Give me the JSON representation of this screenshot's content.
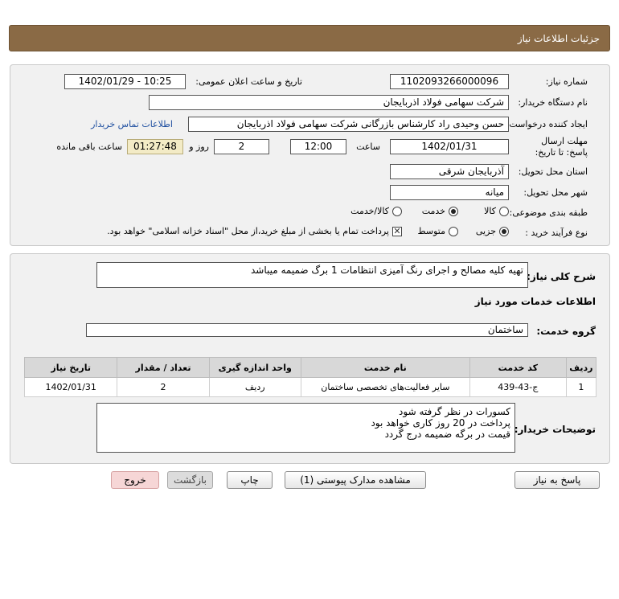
{
  "header": {
    "title": "جزئیات اطلاعات نیاز"
  },
  "form": {
    "need_number_label": "شماره نیاز:",
    "need_number": "1102093266000096",
    "announce_label": "تاریخ و ساعت اعلان عمومی:",
    "announce_value": "1402/01/29 - 10:25",
    "buyer_org_label": "نام دستگاه خریدار:",
    "buyer_org": "شرکت سهامی فولاد اذربایجان",
    "requester_label": "ایجاد کننده درخواست:",
    "requester": "حسن وحیدی راد کارشناس بازرگانی شرکت سهامی فولاد اذربایجان",
    "contact_link": "اطلاعات تماس خریدار",
    "deadline_label": "مهلت ارسال پاسخ: تا تاریخ:",
    "deadline_date": "1402/01/31",
    "time_label": "ساعت",
    "deadline_time": "12:00",
    "days_value": "2",
    "days_label": "روز و",
    "remaining_time": "01:27:48",
    "remaining_label": "ساعت باقی مانده",
    "province_label": "استان محل تحویل:",
    "province": "آذربایجان شرقی",
    "city_label": "شهر محل تحویل:",
    "city": "میانه",
    "category_label": "طبقه بندی موضوعی:",
    "category_options": [
      "کالا",
      "خدمت",
      "کالا/خدمت"
    ],
    "category_selected": "خدمت",
    "process_label": "نوع فرآیند خرید :",
    "process_options": [
      "جزیی",
      "متوسط"
    ],
    "process_selected": "جزیی",
    "treasury_note": "پرداخت تمام یا بخشی از مبلغ خرید،از محل \"اسناد خزانه اسلامی\" خواهد بود."
  },
  "detail": {
    "summary_label": "شرح کلی نیاز:",
    "summary": "تهیه کلیه مصالح و اجرای رنگ آمیزی انتظامات 1 برگ ضمیمه میباشد",
    "services_heading": "اطلاعات خدمات مورد نیاز",
    "service_group_label": "گروه خدمت:",
    "service_group": "ساختمان",
    "table": {
      "headers": [
        "ردیف",
        "کد خدمت",
        "نام خدمت",
        "واحد اندازه گیری",
        "تعداد / مقدار",
        "تاریخ نیاز"
      ],
      "rows": [
        [
          "1",
          "ج-43-439",
          "سایر فعالیت‌های تخصصی ساختمان",
          "ردیف",
          "2",
          "1402/01/31"
        ]
      ]
    },
    "notes_label": "توضیحات خریدار:",
    "notes": [
      "کسورات در نظر گرفته شود",
      "پرداخت در 20 روز کاری خواهد بود",
      "قیمت در برگه ضمیمه درج گردد"
    ]
  },
  "buttons": {
    "reply": "پاسخ به نیاز",
    "view_docs": "مشاهده مدارک پیوستی (1)",
    "print": "چاپ",
    "back": "بازگشت",
    "exit": "خروج"
  }
}
